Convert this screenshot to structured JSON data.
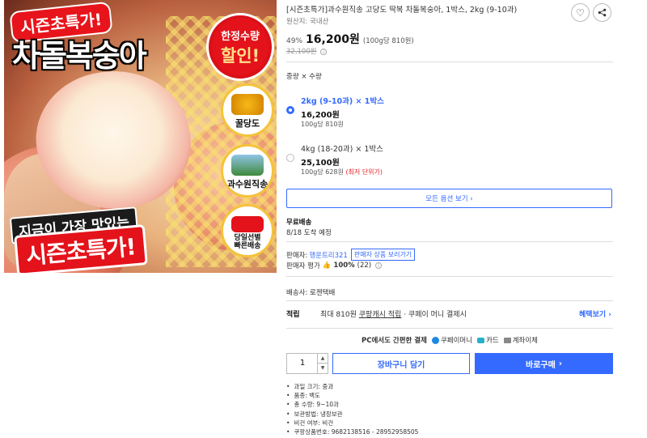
{
  "hero": {
    "tag": "시즌초특가!",
    "title": "차돌복숭아",
    "seal_line1": "한정수량",
    "seal_line2": "할인!",
    "badges": [
      "꿀당도",
      "과수원직송",
      "당일선별\n빠른배송"
    ],
    "banner1": "지금이 가장 맛있는",
    "banner2": "시즌초특가!"
  },
  "product": {
    "title": "[시즌초특가]과수원직송 고당도 딱복 차돌복숭아, 1박스, 2kg (9-10과)",
    "origin": "원산지: 국내산",
    "discount": "49%",
    "price": "16,200원",
    "unit_price": "(100g당 810원)",
    "original_price": "32,100원",
    "info_icon": "ⓘ"
  },
  "options": {
    "label": "중량 × 수량",
    "items": [
      {
        "name": "2kg (9-10과) × 1박스",
        "price": "16,200원",
        "sub": "100g당 810원",
        "extra": "",
        "selected": true
      },
      {
        "name": "4kg (18-20과) × 1박스",
        "price": "25,100원",
        "sub": "100g당 628원",
        "extra": "(최저 단위가)",
        "selected": false
      }
    ],
    "all_button": "모든 옵션 보기 ›"
  },
  "shipping": {
    "title": "무료배송",
    "date": "8/18 도착 예정"
  },
  "seller": {
    "label": "판매자:",
    "name": "행운트리321",
    "button": "판매자 상품 보러가기",
    "rating_label": "판매자 평가",
    "rating_percent": "100%",
    "rating_count": "(22)"
  },
  "courier": "배송사: 로젠택배",
  "points": {
    "label": "적립",
    "text_before": "최대 810원",
    "text_link": "쿠팡캐시 적립",
    "text_after": "· 쿠페이 머니 결제시",
    "benefit": "혜택보기 ›"
  },
  "payment": {
    "intro": "PC에서도 간편한 결제",
    "methods": [
      "쿠페이머니",
      "카드",
      "계좌이체"
    ]
  },
  "purchase": {
    "quantity": "1",
    "cart": "장바구니 담기",
    "buy": "바로구매",
    "buy_arrow": "›"
  },
  "specs": [
    "과일 크기: 중과",
    "품종: 백도",
    "총 수량: 9~10과",
    "보관방법: 냉장보관",
    "비건 여부: 비건",
    "쿠팡상품번호: 9682138516 - 28952958505"
  ],
  "colors": {
    "accent": "#346aff",
    "red": "#e52528"
  }
}
